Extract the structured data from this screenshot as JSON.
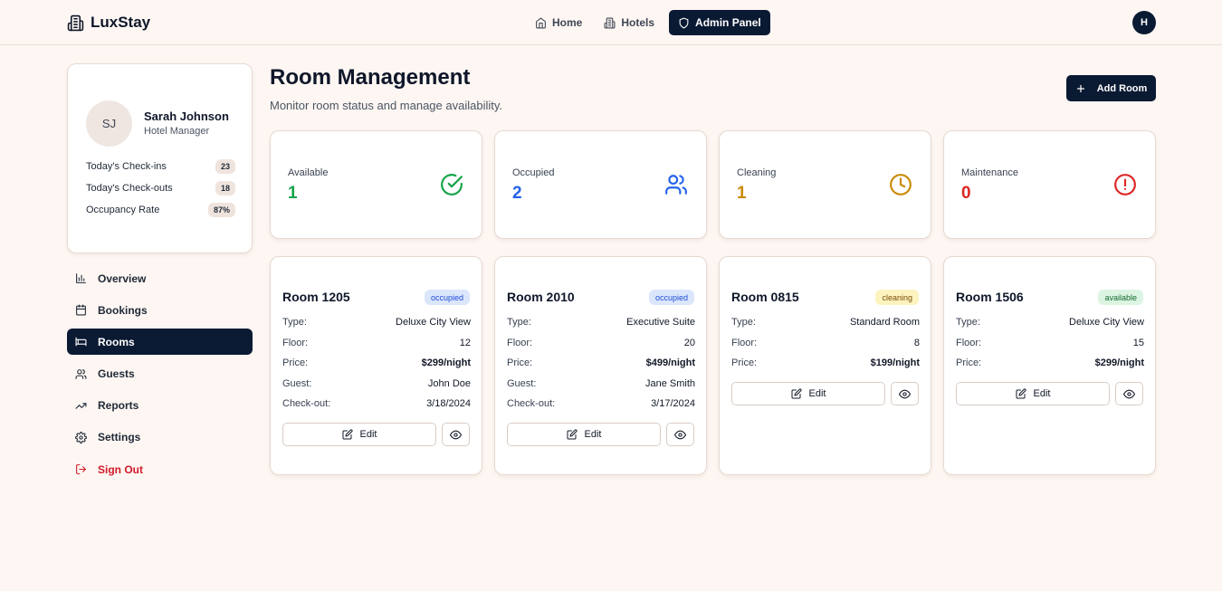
{
  "header": {
    "brand": "LuxStay",
    "nav": [
      {
        "label": "Home",
        "icon": "home-icon"
      },
      {
        "label": "Hotels",
        "icon": "building-icon"
      },
      {
        "label": "Admin Panel",
        "icon": "shield-icon",
        "active": true
      }
    ],
    "user_initial": "H"
  },
  "profile": {
    "initials": "SJ",
    "name": "Sarah Johnson",
    "role": "Hotel Manager",
    "stats": [
      {
        "label": "Today's Check-ins",
        "value": "23"
      },
      {
        "label": "Today's Check-outs",
        "value": "18"
      },
      {
        "label": "Occupancy Rate",
        "value": "87%"
      }
    ]
  },
  "sidebar": {
    "items": [
      {
        "label": "Overview",
        "icon": "bar-chart-icon"
      },
      {
        "label": "Bookings",
        "icon": "calendar-icon"
      },
      {
        "label": "Rooms",
        "icon": "bed-icon",
        "active": true
      },
      {
        "label": "Guests",
        "icon": "users-icon"
      },
      {
        "label": "Reports",
        "icon": "trending-up-icon"
      },
      {
        "label": "Settings",
        "icon": "gear-icon"
      },
      {
        "label": "Sign Out",
        "icon": "sign-out-icon"
      }
    ]
  },
  "main": {
    "title": "Room Management",
    "subtitle": "Monitor room status and manage availability.",
    "add_button": "Add Room"
  },
  "status_summary": [
    {
      "label": "Available",
      "value": "1",
      "color": "#16a34a",
      "icon": "check-circle-icon"
    },
    {
      "label": "Occupied",
      "value": "2",
      "color": "#2563eb",
      "icon": "users-icon"
    },
    {
      "label": "Cleaning",
      "value": "1",
      "color": "#ca8a04",
      "icon": "clock-icon"
    },
    {
      "label": "Maintenance",
      "value": "0",
      "color": "#dc2626",
      "icon": "alert-circle-icon"
    }
  ],
  "field_labels": {
    "type": "Type:",
    "floor": "Floor:",
    "price": "Price:",
    "guest": "Guest:",
    "checkout": "Check-out:"
  },
  "actions": {
    "edit": "Edit"
  },
  "rooms": [
    {
      "name": "Room 1205",
      "status": "occupied",
      "type": "Deluxe City View",
      "floor": "12",
      "price": "$299/night",
      "guest": "John Doe",
      "checkout": "3/18/2024"
    },
    {
      "name": "Room 2010",
      "status": "occupied",
      "type": "Executive Suite",
      "floor": "20",
      "price": "$499/night",
      "guest": "Jane Smith",
      "checkout": "3/17/2024"
    },
    {
      "name": "Room 0815",
      "status": "cleaning",
      "type": "Standard Room",
      "floor": "8",
      "price": "$199/night"
    },
    {
      "name": "Room 1506",
      "status": "available",
      "type": "Deluxe City View",
      "floor": "15",
      "price": "$299/night"
    }
  ]
}
